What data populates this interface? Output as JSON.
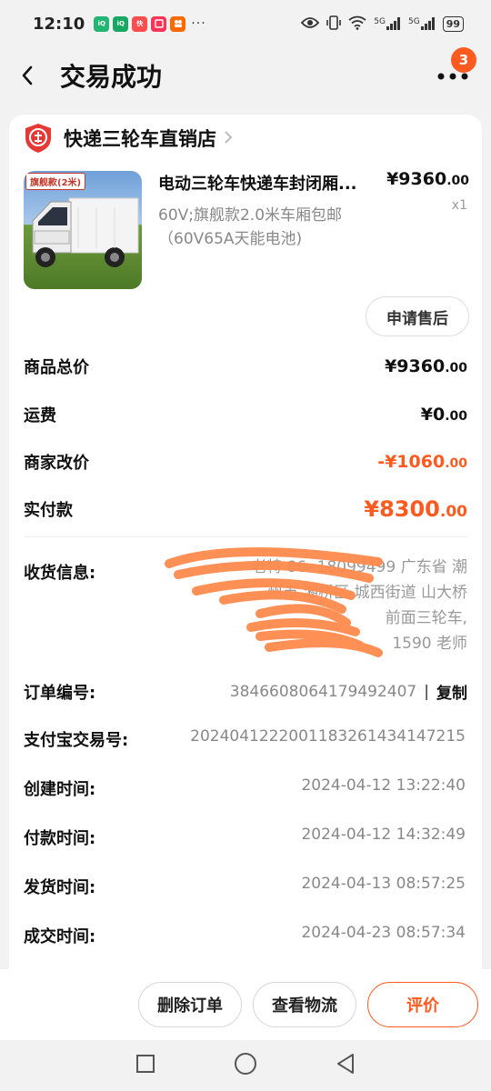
{
  "status_bar": {
    "time": "12:10",
    "app_icons": [
      {
        "name": "iqiyi-icon",
        "text": "iQIYI",
        "color": "#1db954"
      },
      {
        "name": "iqiyi-icon-2",
        "text": "iQIYI",
        "color": "#17b26a"
      },
      {
        "name": "kuaishou-icon",
        "text": "快",
        "color": "#ff4a4a"
      },
      {
        "name": "xiaohongshu-icon",
        "text": "",
        "color": "#ff3355"
      },
      {
        "name": "kuaishou-video-icon",
        "text": "",
        "color": "#ff6a00"
      }
    ],
    "more": "···",
    "network_1": "5G",
    "network_2": "5G",
    "battery": "99"
  },
  "header": {
    "title": "交易成功",
    "badge_count": "3"
  },
  "shop": {
    "name": "快递三轮车直销店"
  },
  "product": {
    "image_tag": "旗舰款(2米)",
    "title": "电动三轮车快递车封闭厢...",
    "spec": "60V;旗舰款2.0米车厢包邮（60V65A天能电池)",
    "price_main": "¥9360",
    "price_decimal": ".00",
    "quantity": "x1",
    "after_sale_label": "申请售后"
  },
  "prices": [
    {
      "label": "商品总价",
      "main": "¥9360",
      "decimal": ".00",
      "style": "normal"
    },
    {
      "label": "运费",
      "main": "¥0",
      "decimal": ".00",
      "style": "normal"
    },
    {
      "label": "商家改价",
      "main": "-¥1060",
      "decimal": ".00",
      "style": "orange"
    },
    {
      "label": "实付款",
      "main": "¥8300",
      "decimal": ".00",
      "style": "orange-big"
    }
  ],
  "info": {
    "receiver_label": "收货信息:",
    "receiver_lines": [
      "老特   86-  18099499   广东省 潮",
      "州市 湘桥区 城西街道       山大桥",
      "                        前面三轮车,",
      "                    1590     老师"
    ],
    "order_no_label": "订单编号:",
    "order_no": "3846608064179492407",
    "copy_label": "复制",
    "alipay_label": "支付宝交易号:",
    "alipay_no": "2024041222001183261434147215",
    "created_label": "创建时间:",
    "created": "2024-04-12 13:22:40",
    "paid_label": "付款时间:",
    "paid": "2024-04-12 14:32:49",
    "shipped_label": "发货时间:",
    "shipped": "2024-04-13 08:57:25",
    "done_label": "成交时间:",
    "done": "2024-04-23 08:57:34"
  },
  "bottom": {
    "delete_label": "删除订单",
    "logistics_label": "查看物流",
    "review_label": "评价"
  },
  "colors": {
    "accent": "#ff5a1f",
    "redaction": "#ff8a4c"
  }
}
